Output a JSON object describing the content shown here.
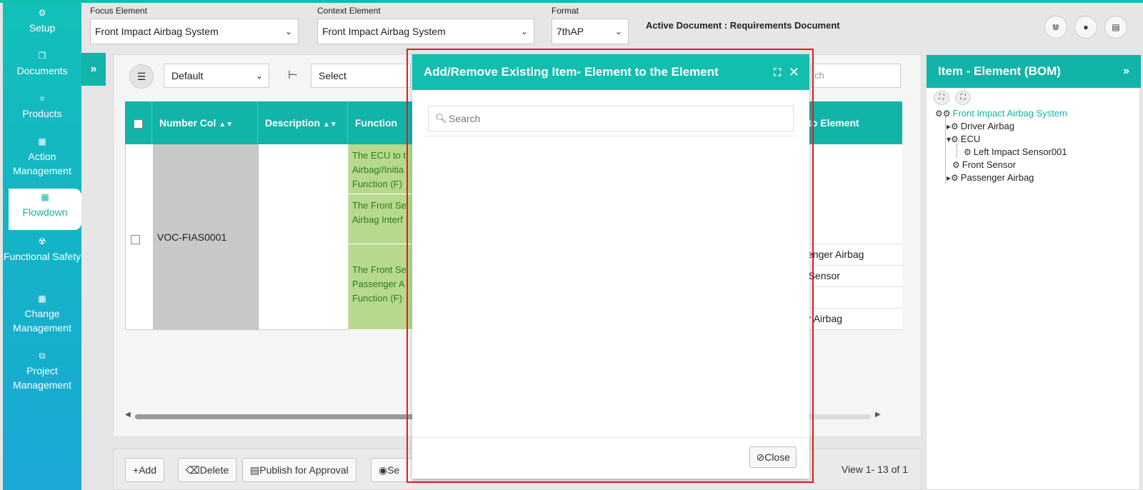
{
  "sidebar": {
    "items": [
      {
        "label": "Setup",
        "icon": "⚙"
      },
      {
        "label": "Documents",
        "icon": "❐"
      },
      {
        "label": "Products",
        "icon": "⌗"
      },
      {
        "label": "Action Management",
        "icon": "▦"
      },
      {
        "label": "Flowdown",
        "icon": "▦"
      },
      {
        "label": "Functional Safety",
        "icon": "☢"
      },
      {
        "label": "Change Management",
        "icon": "▦"
      },
      {
        "label": "Project Management",
        "icon": "⧉"
      }
    ]
  },
  "topbar": {
    "focus_label": "Focus Element",
    "focus_value": "Front Impact Airbag System",
    "context_label": "Context Element",
    "context_value": "Front Impact Airbag System",
    "format_label": "Format",
    "format_value": "7thAP",
    "active_doc": "Active Document : Requirements Document"
  },
  "toolbar": {
    "view_value": "Default",
    "select_value": "Select",
    "search_placeholder": "ch"
  },
  "grid": {
    "headers": {
      "number": "Number Col",
      "description": "Description",
      "function": "Function",
      "relate": "ate to Element"
    },
    "row_number": "VOC-FIAS0001",
    "function_cells": [
      "The ECU to t Airbag//Initia Function (F)",
      "The Front Se Airbag Interf",
      "The Front Se Passenger A Function (F)"
    ],
    "relate_cells": [
      "ssenger Airbag",
      "nt Sensor",
      "",
      "ver Airbag"
    ]
  },
  "bottombar": {
    "add": "Add",
    "delete": "Delete",
    "publish": "Publish for Approval",
    "send": "Se",
    "pager": "View 1- 13 of 1"
  },
  "right_panel": {
    "title": "Item - Element (BOM)",
    "tree": {
      "root": "Front Impact Airbag System",
      "driver": "Driver Airbag",
      "ecu": "ECU",
      "left_sensor": "Left Impact Sensor001",
      "front_sensor": "Front Sensor",
      "passenger": "Passenger Airbag"
    }
  },
  "modal": {
    "title": "Add/Remove Existing Item- Element to the Element",
    "search_placeholder": "Search",
    "close_label": "Close"
  },
  "colors": {
    "teal": "#12b3a8",
    "function_green": "#b7d98d",
    "outline_red": "#e21b1b"
  }
}
